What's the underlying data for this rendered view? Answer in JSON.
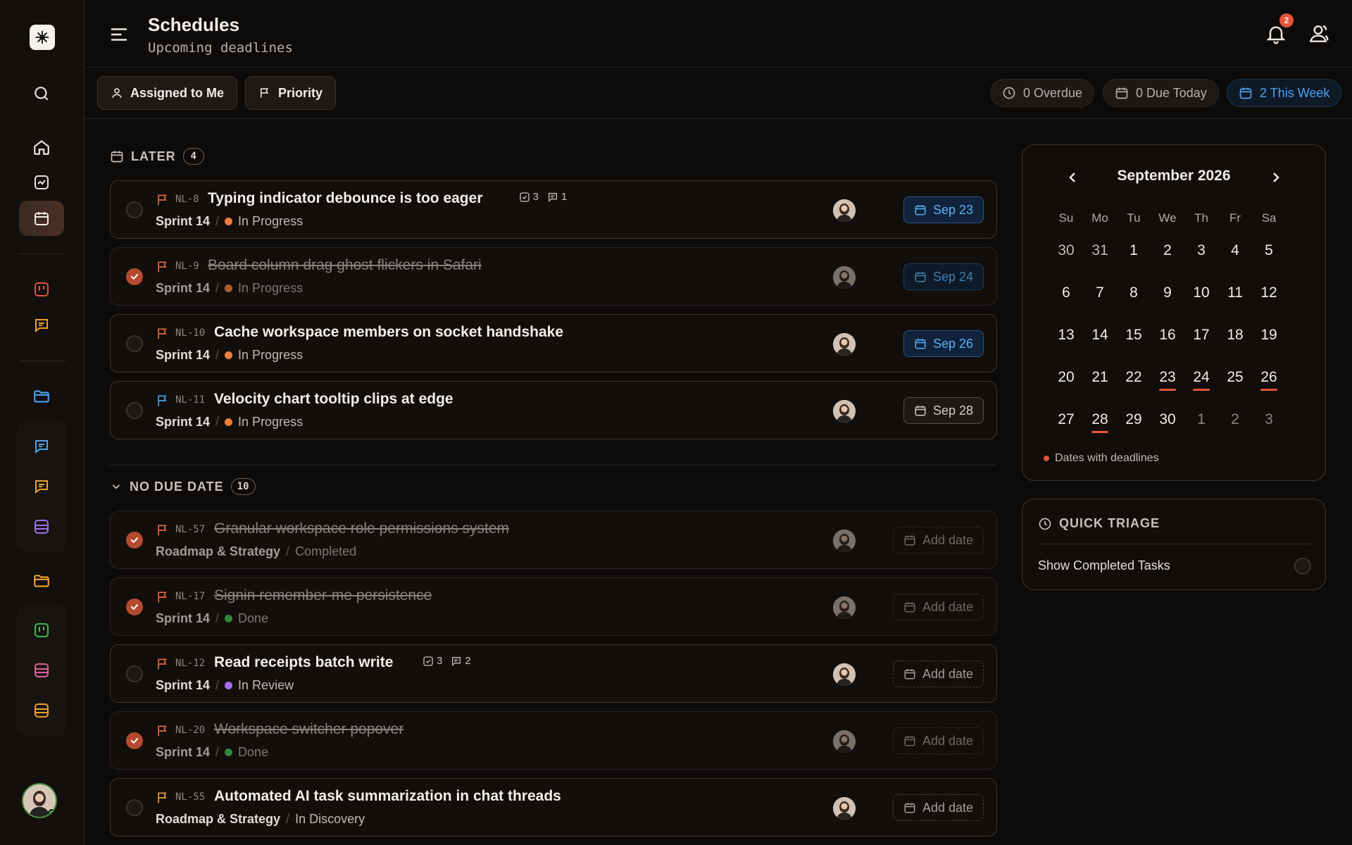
{
  "header": {
    "title": "Schedules",
    "subtitle": "Upcoming deadlines",
    "notification_count": "2"
  },
  "filters": {
    "assigned_label": "Assigned to Me",
    "priority_label": "Priority"
  },
  "stats": {
    "overdue": "0 Overdue",
    "due_today": "0 Due Today",
    "this_week": "2 This Week"
  },
  "sections": {
    "later": {
      "label": "LATER",
      "count": "4"
    },
    "no_due": {
      "label": "NO DUE DATE",
      "count": "10"
    }
  },
  "later_tasks": [
    {
      "id": "NL-8",
      "title": "Typing indicator debounce is too eager",
      "subtasks": "3",
      "comments": "1",
      "project": "Sprint 14",
      "status": "In Progress",
      "status_color": "#f07d3a",
      "flag_color": "#e8683a",
      "date": "Sep 23",
      "done": false
    },
    {
      "id": "NL-9",
      "title": "Board column drag ghost flickers in Safari",
      "project": "Sprint 14",
      "status": "In Progress",
      "status_color": "#f07d3a",
      "flag_color": "#e8683a",
      "date": "Sep 24",
      "done": true
    },
    {
      "id": "NL-10",
      "title": "Cache workspace members on socket handshake",
      "project": "Sprint 14",
      "status": "In Progress",
      "status_color": "#f07d3a",
      "flag_color": "#e8683a",
      "date": "Sep 26",
      "done": false
    },
    {
      "id": "NL-11",
      "title": "Velocity chart tooltip clips at edge",
      "project": "Sprint 14",
      "status": "In Progress",
      "status_color": "#f07d3a",
      "flag_color": "#4a9ff0",
      "date": "Sep 28",
      "done": false
    }
  ],
  "nodue_tasks": [
    {
      "id": "NL-57",
      "title": "Granular workspace role permissions system",
      "project": "Roadmap & Strategy",
      "status": "Completed",
      "flag_color": "#e8683a",
      "date": "Add date",
      "done": true
    },
    {
      "id": "NL-17",
      "title": "Signin remember-me persistence",
      "project": "Sprint 14",
      "status": "Done",
      "status_color": "#3fb950",
      "flag_color": "#e8683a",
      "date": "Add date",
      "done": true
    },
    {
      "id": "NL-12",
      "title": "Read receipts batch write",
      "subtasks": "3",
      "comments": "2",
      "project": "Sprint 14",
      "status": "In Review",
      "status_color": "#a070f0",
      "flag_color": "#e8683a",
      "date": "Add date",
      "done": false
    },
    {
      "id": "NL-20",
      "title": "Workspace switcher popover",
      "project": "Sprint 14",
      "status": "Done",
      "status_color": "#3fb950",
      "flag_color": "#e8683a",
      "date": "Add date",
      "done": true
    },
    {
      "id": "NL-55",
      "title": "Automated AI task summarization in chat threads",
      "project": "Roadmap & Strategy",
      "status": "In Discovery",
      "flag_color": "#f0a030",
      "date": "Add date",
      "done": false
    }
  ],
  "calendar": {
    "month": "September 2026",
    "weekdays": [
      "Su",
      "Mo",
      "Tu",
      "We",
      "Th",
      "Fr",
      "Sa"
    ],
    "days": [
      "30",
      "31",
      "1",
      "2",
      "3",
      "4",
      "5",
      "6",
      "7",
      "8",
      "9",
      "10",
      "11",
      "12",
      "13",
      "14",
      "15",
      "16",
      "17",
      "18",
      "19",
      "20",
      "21",
      "22",
      "23",
      "24",
      "25",
      "26",
      "27",
      "28",
      "29",
      "30",
      "1",
      "2",
      "3"
    ],
    "deadline_days": [
      "23",
      "24",
      "26",
      "28"
    ],
    "legend": "Dates with deadlines"
  },
  "triage": {
    "title": "QUICK TRIAGE",
    "show_completed_label": "Show Completed Tasks"
  },
  "colors": {
    "accent": "#e5533a",
    "blue": "#4aa3f0"
  }
}
